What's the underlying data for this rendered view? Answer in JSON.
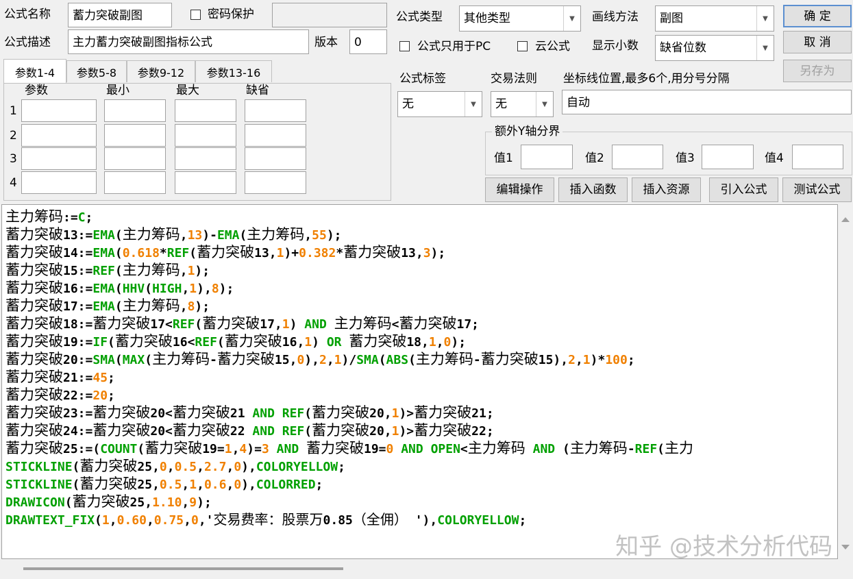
{
  "header": {
    "name_label": "公式名称",
    "name_value": "蓄力突破副图",
    "password_label": "密码保护",
    "password_value": "",
    "desc_label": "公式描述",
    "desc_value": "主力蓄力突破副图指标公式",
    "version_label": "版本",
    "version_value": "0"
  },
  "type_section": {
    "type_label": "公式类型",
    "type_value": "其他类型",
    "draw_label": "画线方法",
    "draw_value": "副图",
    "pc_only_label": "公式只用于PC",
    "cloud_label": "云公式",
    "decimal_label": "显示小数",
    "decimal_value": "缺省位数",
    "tag_label": "公式标签",
    "tag_value": "无",
    "trade_label": "交易法则",
    "trade_value": "无",
    "coord_label": "坐标线位置,最多6个,用分号分隔",
    "coord_value": "自动"
  },
  "yaxis": {
    "title": "额外Y轴分界",
    "v1": "值1",
    "v2": "值2",
    "v3": "值3",
    "v4": "值4"
  },
  "buttons": {
    "ok": "确 定",
    "cancel": "取 消",
    "save_as": "另存为",
    "edit": "编辑操作",
    "insert_func": "插入函数",
    "insert_res": "插入资源",
    "import": "引入公式",
    "test": "测试公式"
  },
  "params": {
    "tabs": [
      "参数1-4",
      "参数5-8",
      "参数9-12",
      "参数13-16"
    ],
    "headers": [
      "参数",
      "最小",
      "最大",
      "缺省"
    ],
    "rows": [
      "1",
      "2",
      "3",
      "4"
    ]
  },
  "code_lines": [
    [
      [
        "cn",
        "主力筹码"
      ],
      [
        "op",
        ":="
      ],
      [
        "kw",
        "C"
      ],
      [
        "op",
        ";"
      ]
    ],
    [
      [
        "cn",
        "蓄力突破"
      ],
      [
        "op",
        "13:="
      ],
      [
        "kw",
        "EMA"
      ],
      [
        "op",
        "("
      ],
      [
        "cn",
        "主力筹码"
      ],
      [
        "op",
        ","
      ],
      [
        "num",
        "13"
      ],
      [
        "op",
        ")-"
      ],
      [
        "kw",
        "EMA"
      ],
      [
        "op",
        "("
      ],
      [
        "cn",
        "主力筹码"
      ],
      [
        "op",
        ","
      ],
      [
        "num",
        "55"
      ],
      [
        "op",
        ");"
      ]
    ],
    [
      [
        "cn",
        "蓄力突破"
      ],
      [
        "op",
        "14:="
      ],
      [
        "kw",
        "EMA"
      ],
      [
        "op",
        "("
      ],
      [
        "num",
        "0.618"
      ],
      [
        "op",
        "*"
      ],
      [
        "kw",
        "REF"
      ],
      [
        "op",
        "("
      ],
      [
        "cn",
        "蓄力突破"
      ],
      [
        "op",
        "13,"
      ],
      [
        "num",
        "1"
      ],
      [
        "op",
        ")+"
      ],
      [
        "num",
        "0.382"
      ],
      [
        "op",
        "*"
      ],
      [
        "cn",
        "蓄力突破"
      ],
      [
        "op",
        "13,"
      ],
      [
        "num",
        "3"
      ],
      [
        "op",
        ");"
      ]
    ],
    [
      [
        "cn",
        "蓄力突破"
      ],
      [
        "op",
        "15:="
      ],
      [
        "kw",
        "REF"
      ],
      [
        "op",
        "("
      ],
      [
        "cn",
        "主力筹码"
      ],
      [
        "op",
        ","
      ],
      [
        "num",
        "1"
      ],
      [
        "op",
        ");"
      ]
    ],
    [
      [
        "cn",
        "蓄力突破"
      ],
      [
        "op",
        "16:="
      ],
      [
        "kw",
        "EMA"
      ],
      [
        "op",
        "("
      ],
      [
        "kw",
        "HHV"
      ],
      [
        "op",
        "("
      ],
      [
        "kw",
        "HIGH"
      ],
      [
        "op",
        ","
      ],
      [
        "num",
        "1"
      ],
      [
        "op",
        "),"
      ],
      [
        "num",
        "8"
      ],
      [
        "op",
        ");"
      ]
    ],
    [
      [
        "cn",
        "蓄力突破"
      ],
      [
        "op",
        "17:="
      ],
      [
        "kw",
        "EMA"
      ],
      [
        "op",
        "("
      ],
      [
        "cn",
        "主力筹码"
      ],
      [
        "op",
        ","
      ],
      [
        "num",
        "8"
      ],
      [
        "op",
        ");"
      ]
    ],
    [
      [
        "cn",
        "蓄力突破"
      ],
      [
        "op",
        "18:="
      ],
      [
        "cn",
        "蓄力突破"
      ],
      [
        "op",
        "17<"
      ],
      [
        "kw",
        "REF"
      ],
      [
        "op",
        "("
      ],
      [
        "cn",
        "蓄力突破"
      ],
      [
        "op",
        "17,"
      ],
      [
        "num",
        "1"
      ],
      [
        "op",
        ") "
      ],
      [
        "kw",
        "AND"
      ],
      [
        "op",
        " "
      ],
      [
        "cn",
        "主力筹码"
      ],
      [
        "op",
        "<"
      ],
      [
        "cn",
        "蓄力突破"
      ],
      [
        "op",
        "17;"
      ]
    ],
    [
      [
        "cn",
        "蓄力突破"
      ],
      [
        "op",
        "19:="
      ],
      [
        "kw",
        "IF"
      ],
      [
        "op",
        "("
      ],
      [
        "cn",
        "蓄力突破"
      ],
      [
        "op",
        "16<"
      ],
      [
        "kw",
        "REF"
      ],
      [
        "op",
        "("
      ],
      [
        "cn",
        "蓄力突破"
      ],
      [
        "op",
        "16,"
      ],
      [
        "num",
        "1"
      ],
      [
        "op",
        ") "
      ],
      [
        "kw",
        "OR"
      ],
      [
        "op",
        " "
      ],
      [
        "cn",
        "蓄力突破"
      ],
      [
        "op",
        "18,"
      ],
      [
        "num",
        "1"
      ],
      [
        "op",
        ","
      ],
      [
        "num",
        "0"
      ],
      [
        "op",
        ");"
      ]
    ],
    [
      [
        "cn",
        "蓄力突破"
      ],
      [
        "op",
        "20:="
      ],
      [
        "kw",
        "SMA"
      ],
      [
        "op",
        "("
      ],
      [
        "kw",
        "MAX"
      ],
      [
        "op",
        "("
      ],
      [
        "cn",
        "主力筹码"
      ],
      [
        "op",
        "-"
      ],
      [
        "cn",
        "蓄力突破"
      ],
      [
        "op",
        "15,"
      ],
      [
        "num",
        "0"
      ],
      [
        "op",
        "),"
      ],
      [
        "num",
        "2"
      ],
      [
        "op",
        ","
      ],
      [
        "num",
        "1"
      ],
      [
        "op",
        ")/"
      ],
      [
        "kw",
        "SMA"
      ],
      [
        "op",
        "("
      ],
      [
        "kw",
        "ABS"
      ],
      [
        "op",
        "("
      ],
      [
        "cn",
        "主力筹码"
      ],
      [
        "op",
        "-"
      ],
      [
        "cn",
        "蓄力突破"
      ],
      [
        "op",
        "15),"
      ],
      [
        "num",
        "2"
      ],
      [
        "op",
        ","
      ],
      [
        "num",
        "1"
      ],
      [
        "op",
        ")*"
      ],
      [
        "num",
        "100"
      ],
      [
        "op",
        ";"
      ]
    ],
    [
      [
        "cn",
        "蓄力突破"
      ],
      [
        "op",
        "21:="
      ],
      [
        "num",
        "45"
      ],
      [
        "op",
        ";"
      ]
    ],
    [
      [
        "cn",
        "蓄力突破"
      ],
      [
        "op",
        "22:="
      ],
      [
        "num",
        "20"
      ],
      [
        "op",
        ";"
      ]
    ],
    [
      [
        "cn",
        "蓄力突破"
      ],
      [
        "op",
        "23:="
      ],
      [
        "cn",
        "蓄力突破"
      ],
      [
        "op",
        "20<"
      ],
      [
        "cn",
        "蓄力突破"
      ],
      [
        "op",
        "21 "
      ],
      [
        "kw",
        "AND"
      ],
      [
        "op",
        " "
      ],
      [
        "kw",
        "REF"
      ],
      [
        "op",
        "("
      ],
      [
        "cn",
        "蓄力突破"
      ],
      [
        "op",
        "20,"
      ],
      [
        "num",
        "1"
      ],
      [
        "op",
        ")>"
      ],
      [
        "cn",
        "蓄力突破"
      ],
      [
        "op",
        "21;"
      ]
    ],
    [
      [
        "cn",
        "蓄力突破"
      ],
      [
        "op",
        "24:="
      ],
      [
        "cn",
        "蓄力突破"
      ],
      [
        "op",
        "20<"
      ],
      [
        "cn",
        "蓄力突破"
      ],
      [
        "op",
        "22 "
      ],
      [
        "kw",
        "AND"
      ],
      [
        "op",
        " "
      ],
      [
        "kw",
        "REF"
      ],
      [
        "op",
        "("
      ],
      [
        "cn",
        "蓄力突破"
      ],
      [
        "op",
        "20,"
      ],
      [
        "num",
        "1"
      ],
      [
        "op",
        ")>"
      ],
      [
        "cn",
        "蓄力突破"
      ],
      [
        "op",
        "22;"
      ]
    ],
    [
      [
        "cn",
        "蓄力突破"
      ],
      [
        "op",
        "25:=("
      ],
      [
        "kw",
        "COUNT"
      ],
      [
        "op",
        "("
      ],
      [
        "cn",
        "蓄力突破"
      ],
      [
        "op",
        "19="
      ],
      [
        "num",
        "1"
      ],
      [
        "op",
        ","
      ],
      [
        "num",
        "4"
      ],
      [
        "op",
        ")="
      ],
      [
        "num",
        "3"
      ],
      [
        "op",
        " "
      ],
      [
        "kw",
        "AND"
      ],
      [
        "op",
        " "
      ],
      [
        "cn",
        "蓄力突破"
      ],
      [
        "op",
        "19="
      ],
      [
        "num",
        "0"
      ],
      [
        "op",
        " "
      ],
      [
        "kw",
        "AND"
      ],
      [
        "op",
        " "
      ],
      [
        "kw",
        "OPEN"
      ],
      [
        "op",
        "<"
      ],
      [
        "cn",
        "主力筹码"
      ],
      [
        "op",
        " "
      ],
      [
        "kw",
        "AND"
      ],
      [
        "op",
        " ("
      ],
      [
        "cn",
        "主力筹码"
      ],
      [
        "op",
        "-"
      ],
      [
        "kw",
        "REF"
      ],
      [
        "op",
        "("
      ],
      [
        "cn",
        "主力"
      ]
    ],
    [
      [
        "kw",
        "STICKLINE"
      ],
      [
        "op",
        "("
      ],
      [
        "cn",
        "蓄力突破"
      ],
      [
        "op",
        "25,"
      ],
      [
        "num",
        "0"
      ],
      [
        "op",
        ","
      ],
      [
        "num",
        "0.5"
      ],
      [
        "op",
        ","
      ],
      [
        "num",
        "2.7"
      ],
      [
        "op",
        ","
      ],
      [
        "num",
        "0"
      ],
      [
        "op",
        "),"
      ],
      [
        "kw",
        "COLORYELLOW"
      ],
      [
        "op",
        ";"
      ]
    ],
    [
      [
        "kw",
        "STICKLINE"
      ],
      [
        "op",
        "("
      ],
      [
        "cn",
        "蓄力突破"
      ],
      [
        "op",
        "25,"
      ],
      [
        "num",
        "0.5"
      ],
      [
        "op",
        ","
      ],
      [
        "num",
        "1"
      ],
      [
        "op",
        ","
      ],
      [
        "num",
        "0.6"
      ],
      [
        "op",
        ","
      ],
      [
        "num",
        "0"
      ],
      [
        "op",
        "),"
      ],
      [
        "kw",
        "COLORRED"
      ],
      [
        "op",
        ";"
      ]
    ],
    [
      [
        "kw",
        "DRAWICON"
      ],
      [
        "op",
        "("
      ],
      [
        "cn",
        "蓄力突破"
      ],
      [
        "op",
        "25,"
      ],
      [
        "num",
        "1.10"
      ],
      [
        "op",
        ","
      ],
      [
        "num",
        "9"
      ],
      [
        "op",
        ");"
      ]
    ],
    [
      [
        "kw",
        "DRAWTEXT_FIX"
      ],
      [
        "op",
        "("
      ],
      [
        "num",
        "1"
      ],
      [
        "op",
        ","
      ],
      [
        "num",
        "0.60"
      ],
      [
        "op",
        ","
      ],
      [
        "num",
        "0.75"
      ],
      [
        "op",
        ","
      ],
      [
        "num",
        "0"
      ],
      [
        "op",
        ",'"
      ],
      [
        "str",
        "交易费率：股票万"
      ],
      [
        "op",
        "0.85"
      ],
      [
        "str",
        "（全佣）"
      ],
      [
        "op",
        " '),"
      ],
      [
        "kw",
        "COLORYELLOW"
      ],
      [
        "op",
        ";"
      ]
    ]
  ],
  "watermark": "知乎 @技术分析代码"
}
